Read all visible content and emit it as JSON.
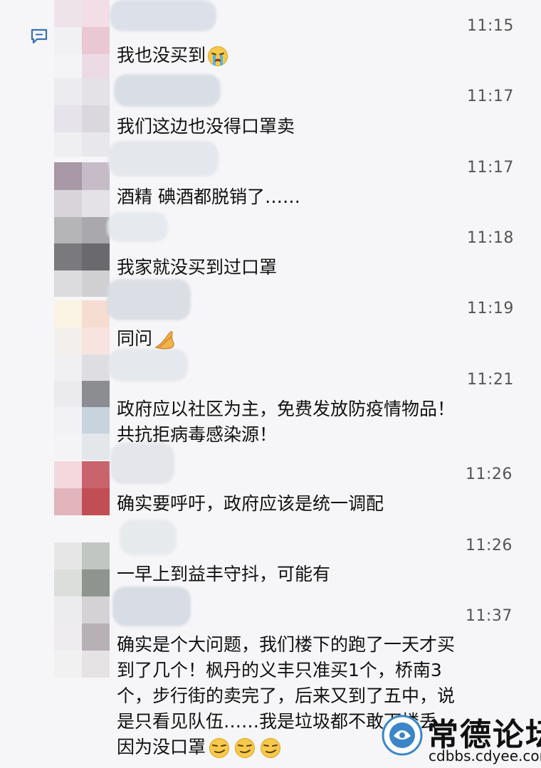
{
  "messages": [
    {
      "time": "11:15",
      "text": "我也没买到",
      "emoji": "crying-face-icon"
    },
    {
      "time": "11:17",
      "text": "我们这边也没得口罩卖"
    },
    {
      "time": "11:17",
      "text": "酒精 碘酒都脱销了……"
    },
    {
      "time": "11:18",
      "text": "我家就没买到过口罩"
    },
    {
      "time": "11:19",
      "text": "同问",
      "emoji": "folded-hands-icon"
    },
    {
      "time": "11:21",
      "lines": [
        "政府应以社区为主，免费发放防疫情物品！",
        "共抗拒病毒感染源！"
      ]
    },
    {
      "time": "11:26",
      "text": "确实要呼吁，政府应该是统一调配"
    },
    {
      "time": "11:26",
      "text": "一早上到益丰守抖，可能有"
    },
    {
      "time": "11:37",
      "lines": [
        "确实是个大问题，我们楼下的跑了一天才买",
        "到了几个！枫丹的义丰只准买1个，桥南3",
        "个，步行街的卖完了，后来又到了五中，说",
        "是只看见队伍……我是垃圾都不敢下楼丢",
        "因为没口罩"
      ],
      "emoji": "smirking-face-icon"
    }
  ],
  "watermark": {
    "site_name": "常德论坛",
    "url": "cdbbs.cdyee.com"
  },
  "colors": {
    "background": "#f6f6f8",
    "text": "#111111",
    "time": "#555555",
    "accent": "#3b6fb3"
  }
}
